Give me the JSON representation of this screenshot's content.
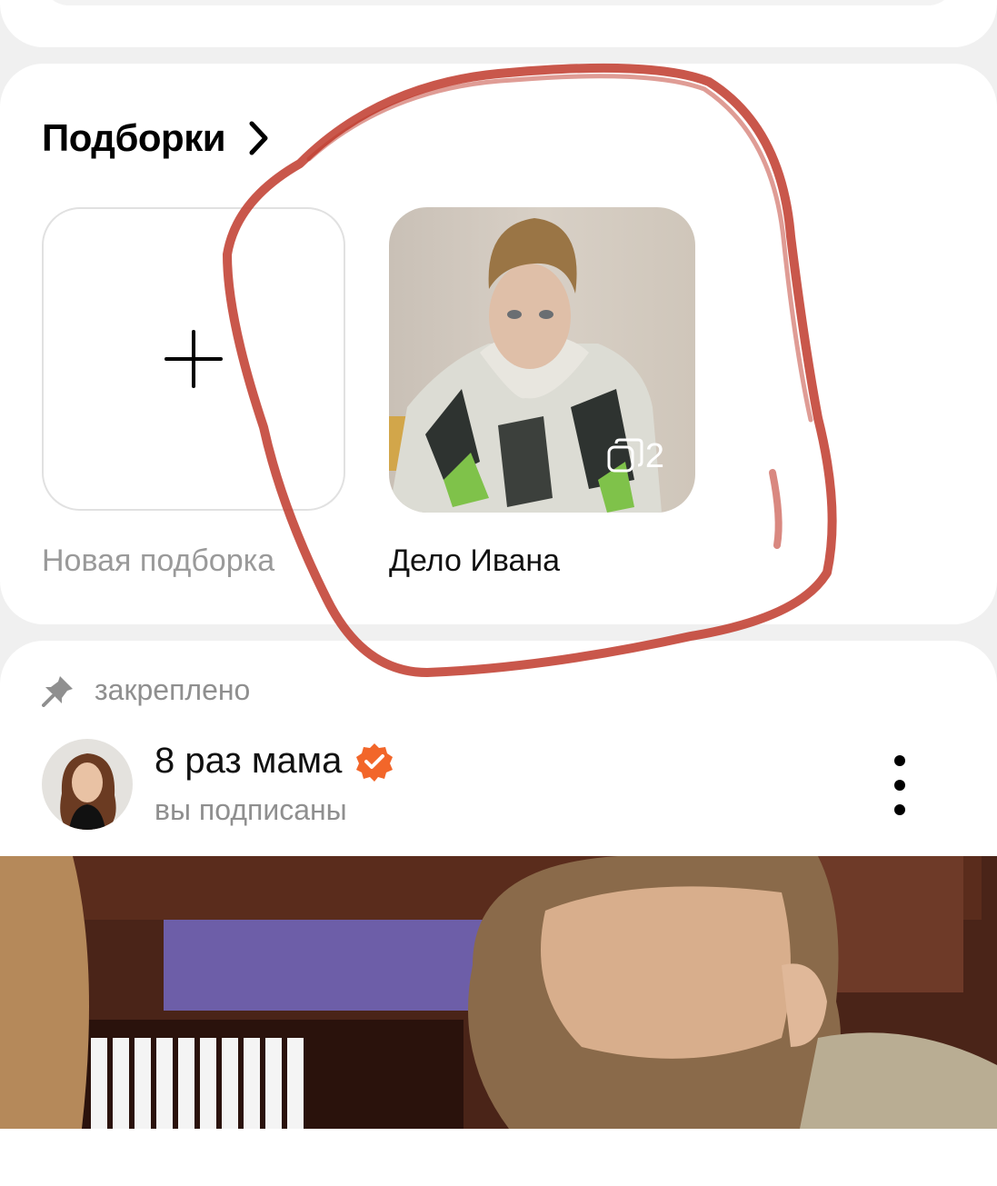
{
  "collections": {
    "title": "Подборки",
    "new_collection_label": "Новая подборка",
    "items": [
      {
        "label": "Дело Ивана",
        "photo_count": "2"
      }
    ]
  },
  "post": {
    "pinned_label": "закреплено",
    "author_name": "8 раз мама",
    "author_status": "вы подписаны"
  },
  "colors": {
    "verified_badge": "#f2662a",
    "annotation_scribble": "#c0392b"
  },
  "icons": {
    "collections_chevron": "chevron-right-icon",
    "add": "plus-icon",
    "album_count": "stacked-photos-icon",
    "pinned": "pin-icon",
    "verified": "verified-badge-icon",
    "more": "more-vertical-icon"
  }
}
